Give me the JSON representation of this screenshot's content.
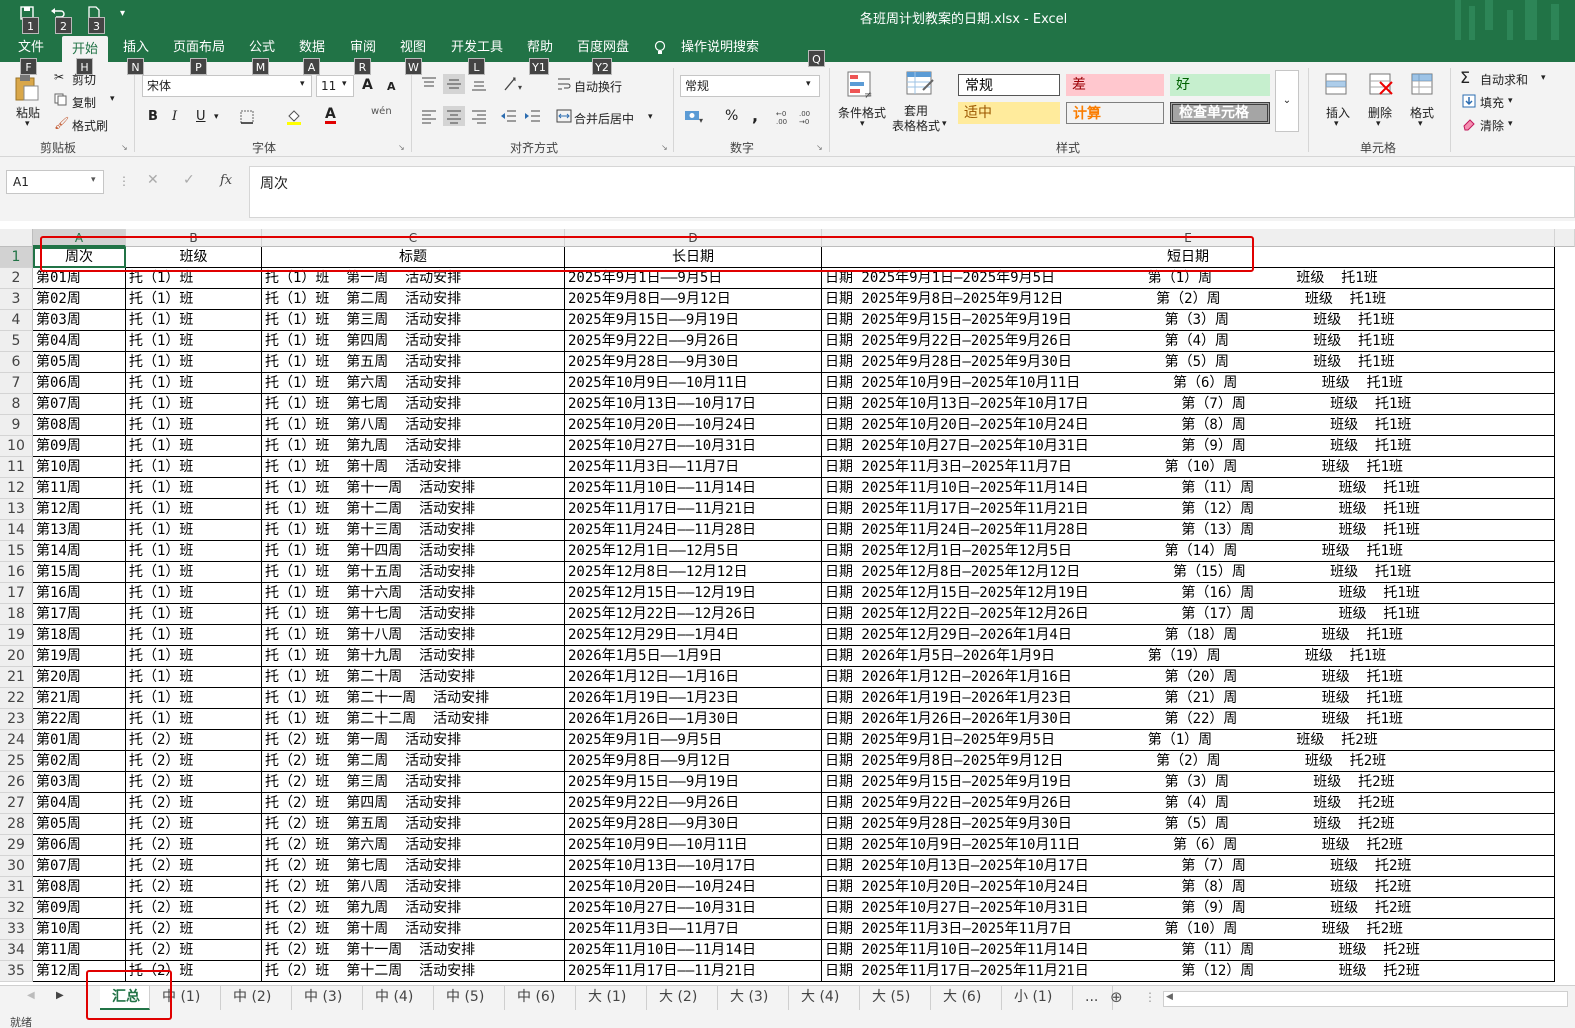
{
  "window": {
    "title": "各班周计划教案的日期.xlsx  -  Excel"
  },
  "qat": {
    "keytips": [
      "1",
      "2",
      "3"
    ]
  },
  "menu": {
    "tabs": [
      {
        "label": "文件",
        "keytip": "F"
      },
      {
        "label": "开始",
        "keytip": "H"
      },
      {
        "label": "插入",
        "keytip": "N"
      },
      {
        "label": "页面布局",
        "keytip": "P"
      },
      {
        "label": "公式",
        "keytip": "M"
      },
      {
        "label": "数据",
        "keytip": "A"
      },
      {
        "label": "审阅",
        "keytip": "R"
      },
      {
        "label": "视图",
        "keytip": "W"
      },
      {
        "label": "开发工具",
        "keytip": "L"
      },
      {
        "label": "帮助",
        "keytip": "Y1"
      },
      {
        "label": "百度网盘",
        "keytip": "Y2"
      },
      {
        "label": "操作说明搜索",
        "keytip": "Q"
      }
    ]
  },
  "ribbon": {
    "clipboard": {
      "paste": "粘贴",
      "cut": "剪切",
      "copy": "复制",
      "format_painter": "格式刷",
      "label": "剪贴板"
    },
    "font": {
      "name": "宋体",
      "size": "11",
      "label": "字体",
      "bold": "B",
      "italic": "I",
      "underline": "U",
      "grow": "A",
      "shrink": "A",
      "font_color": "A",
      "phonetic": "wén"
    },
    "alignment": {
      "wrap": "自动换行",
      "merge": "合并后居中",
      "label": "对齐方式"
    },
    "number": {
      "format": "常规",
      "label": "数字",
      "percent": "%",
      "comma": ","
    },
    "styles": {
      "cond_format": "条件格式",
      "table_format": "套用\n表格格式",
      "cells": [
        {
          "label": "常规",
          "bg": "#ffffff",
          "color": "#000000"
        },
        {
          "label": "差",
          "bg": "#ffc7ce",
          "color": "#9c0006"
        },
        {
          "label": "好",
          "bg": "#c6efce",
          "color": "#006100"
        },
        {
          "label": "适中",
          "bg": "#ffeb9c",
          "color": "#9c5700"
        },
        {
          "label": "计算",
          "bg": "#f2f2f2",
          "color": "#fa7d00"
        },
        {
          "label": "检查单元格",
          "bg": "#a5a5a5",
          "color": "#ffffff"
        }
      ],
      "label": "样式"
    },
    "cells": {
      "insert": "插入",
      "delete": "删除",
      "format": "格式",
      "label": "单元格"
    },
    "editing": {
      "autosum": "自动求和",
      "fill": "填充",
      "clear": "清除"
    }
  },
  "formula_bar": {
    "name_box": "A1",
    "fx": "fx",
    "content": "周次"
  },
  "columns": [
    "A",
    "B",
    "C",
    "D",
    "E"
  ],
  "header_row": [
    "周次",
    "班级",
    "标题",
    "长日期",
    "短日期"
  ],
  "rows": [
    [
      "第01周",
      "托（1）班",
      "托（1）班  第一周  活动安排",
      "2025年9月1日——9月5日",
      "日期 2025年9月1日—2025年9月5日           第（1）周          班级  托1班"
    ],
    [
      "第02周",
      "托（1）班",
      "托（1）班  第二周  活动安排",
      "2025年9月8日——9月12日",
      "日期 2025年9月8日—2025年9月12日           第（2）周          班级  托1班"
    ],
    [
      "第03周",
      "托（1）班",
      "托（1）班  第三周  活动安排",
      "2025年9月15日——9月19日",
      "日期 2025年9月15日—2025年9月19日           第（3）周          班级  托1班"
    ],
    [
      "第04周",
      "托（1）班",
      "托（1）班  第四周  活动安排",
      "2025年9月22日——9月26日",
      "日期 2025年9月22日—2025年9月26日           第（4）周          班级  托1班"
    ],
    [
      "第05周",
      "托（1）班",
      "托（1）班  第五周  活动安排",
      "2025年9月28日——9月30日",
      "日期 2025年9月28日—2025年9月30日           第（5）周          班级  托1班"
    ],
    [
      "第06周",
      "托（1）班",
      "托（1）班  第六周  活动安排",
      "2025年10月9日——10月11日",
      "日期 2025年10月9日—2025年10月11日           第（6）周          班级  托1班"
    ],
    [
      "第07周",
      "托（1）班",
      "托（1）班  第七周  活动安排",
      "2025年10月13日——10月17日",
      "日期 2025年10月13日—2025年10月17日           第（7）周          班级  托1班"
    ],
    [
      "第08周",
      "托（1）班",
      "托（1）班  第八周  活动安排",
      "2025年10月20日——10月24日",
      "日期 2025年10月20日—2025年10月24日           第（8）周          班级  托1班"
    ],
    [
      "第09周",
      "托（1）班",
      "托（1）班  第九周  活动安排",
      "2025年10月27日——10月31日",
      "日期 2025年10月27日—2025年10月31日           第（9）周          班级  托1班"
    ],
    [
      "第10周",
      "托（1）班",
      "托（1）班  第十周  活动安排",
      "2025年11月3日——11月7日",
      "日期 2025年11月3日—2025年11月7日           第（10）周          班级  托1班"
    ],
    [
      "第11周",
      "托（1）班",
      "托（1）班  第十一周  活动安排",
      "2025年11月10日——11月14日",
      "日期 2025年11月10日—2025年11月14日           第（11）周          班级  托1班"
    ],
    [
      "第12周",
      "托（1）班",
      "托（1）班  第十二周  活动安排",
      "2025年11月17日——11月21日",
      "日期 2025年11月17日—2025年11月21日           第（12）周          班级  托1班"
    ],
    [
      "第13周",
      "托（1）班",
      "托（1）班  第十三周  活动安排",
      "2025年11月24日——11月28日",
      "日期 2025年11月24日—2025年11月28日           第（13）周          班级  托1班"
    ],
    [
      "第14周",
      "托（1）班",
      "托（1）班  第十四周  活动安排",
      "2025年12月1日——12月5日",
      "日期 2025年12月1日—2025年12月5日           第（14）周          班级  托1班"
    ],
    [
      "第15周",
      "托（1）班",
      "托（1）班  第十五周  活动安排",
      "2025年12月8日——12月12日",
      "日期 2025年12月8日—2025年12月12日           第（15）周          班级  托1班"
    ],
    [
      "第16周",
      "托（1）班",
      "托（1）班  第十六周  活动安排",
      "2025年12月15日——12月19日",
      "日期 2025年12月15日—2025年12月19日           第（16）周          班级  托1班"
    ],
    [
      "第17周",
      "托（1）班",
      "托（1）班  第十七周  活动安排",
      "2025年12月22日——12月26日",
      "日期 2025年12月22日—2025年12月26日           第（17）周          班级  托1班"
    ],
    [
      "第18周",
      "托（1）班",
      "托（1）班  第十八周  活动安排",
      "2025年12月29日——1月4日",
      "日期 2025年12月29日—2026年1月4日           第（18）周          班级  托1班"
    ],
    [
      "第19周",
      "托（1）班",
      "托（1）班  第十九周  活动安排",
      "2026年1月5日——1月9日",
      "日期 2026年1月5日—2026年1月9日           第（19）周          班级  托1班"
    ],
    [
      "第20周",
      "托（1）班",
      "托（1）班  第二十周  活动安排",
      "2026年1月12日——1月16日",
      "日期 2026年1月12日—2026年1月16日           第（20）周          班级  托1班"
    ],
    [
      "第21周",
      "托（1）班",
      "托（1）班  第二十一周  活动安排",
      "2026年1月19日——1月23日",
      "日期 2026年1月19日—2026年1月23日           第（21）周          班级  托1班"
    ],
    [
      "第22周",
      "托（1）班",
      "托（1）班  第二十二周  活动安排",
      "2026年1月26日——1月30日",
      "日期 2026年1月26日—2026年1月30日           第（22）周          班级  托1班"
    ],
    [
      "第01周",
      "托（2）班",
      "托（2）班  第一周  活动安排",
      "2025年9月1日——9月5日",
      "日期 2025年9月1日—2025年9月5日           第（1）周          班级  托2班"
    ],
    [
      "第02周",
      "托（2）班",
      "托（2）班  第二周  活动安排",
      "2025年9月8日——9月12日",
      "日期 2025年9月8日—2025年9月12日           第（2）周          班级  托2班"
    ],
    [
      "第03周",
      "托（2）班",
      "托（2）班  第三周  活动安排",
      "2025年9月15日——9月19日",
      "日期 2025年9月15日—2025年9月19日           第（3）周          班级  托2班"
    ],
    [
      "第04周",
      "托（2）班",
      "托（2）班  第四周  活动安排",
      "2025年9月22日——9月26日",
      "日期 2025年9月22日—2025年9月26日           第（4）周          班级  托2班"
    ],
    [
      "第05周",
      "托（2）班",
      "托（2）班  第五周  活动安排",
      "2025年9月28日——9月30日",
      "日期 2025年9月28日—2025年9月30日           第（5）周          班级  托2班"
    ],
    [
      "第06周",
      "托（2）班",
      "托（2）班  第六周  活动安排",
      "2025年10月9日——10月11日",
      "日期 2025年10月9日—2025年10月11日           第（6）周          班级  托2班"
    ],
    [
      "第07周",
      "托（2）班",
      "托（2）班  第七周  活动安排",
      "2025年10月13日——10月17日",
      "日期 2025年10月13日—2025年10月17日           第（7）周          班级  托2班"
    ],
    [
      "第08周",
      "托（2）班",
      "托（2）班  第八周  活动安排",
      "2025年10月20日——10月24日",
      "日期 2025年10月20日—2025年10月24日           第（8）周          班级  托2班"
    ],
    [
      "第09周",
      "托（2）班",
      "托（2）班  第九周  活动安排",
      "2025年10月27日——10月31日",
      "日期 2025年10月27日—2025年10月31日           第（9）周          班级  托2班"
    ],
    [
      "第10周",
      "托（2）班",
      "托（2）班  第十周  活动安排",
      "2025年11月3日——11月7日",
      "日期 2025年11月3日—2025年11月7日           第（10）周          班级  托2班"
    ],
    [
      "第11周",
      "托（2）班",
      "托（2）班  第十一周  活动安排",
      "2025年11月10日——11月14日",
      "日期 2025年11月10日—2025年11月14日           第（11）周          班级  托2班"
    ],
    [
      "第12周",
      "托（2）班",
      "托（2）班  第十二周  活动安排",
      "2025年11月17日——11月21日",
      "日期 2025年11月17日—2025年11月21日           第（12）周          班级  托2班"
    ]
  ],
  "sheets": [
    "汇总",
    "中 (1)",
    "中 (2)",
    "中 (3)",
    "中 (4)",
    "中 (5)",
    "中 (6)",
    "大 (1)",
    "大 (2)",
    "大 (3)",
    "大 (4)",
    "大 (5)",
    "大 (6)",
    "小 (1)",
    "..."
  ],
  "active_sheet": "汇总",
  "status": {
    "ready": "就绪"
  }
}
